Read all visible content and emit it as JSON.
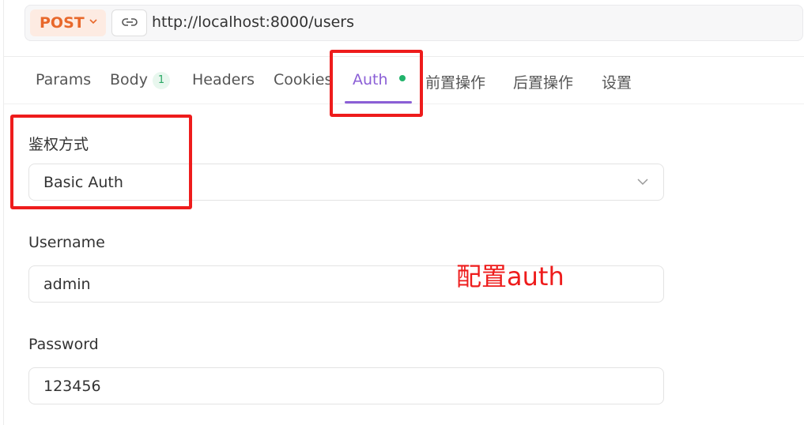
{
  "request": {
    "method": "POST",
    "url": "http://localhost:8000/users"
  },
  "tabs": {
    "params": "Params",
    "body": "Body",
    "body_count": "1",
    "headers": "Headers",
    "cookies": "Cookies",
    "auth": "Auth",
    "pre_ops": "前置操作",
    "post_ops": "后置操作",
    "settings": "设置"
  },
  "auth": {
    "method_label": "鉴权方式",
    "method_value": "Basic Auth",
    "username_label": "Username",
    "username_value": "admin",
    "password_label": "Password",
    "password_value": "123456"
  },
  "annotation": {
    "text": "配置auth"
  },
  "colors": {
    "method": "#e8682b",
    "active_tab": "#8b5fd6",
    "status_dot": "#21b36b",
    "annotation_red": "#ee1c1c"
  }
}
